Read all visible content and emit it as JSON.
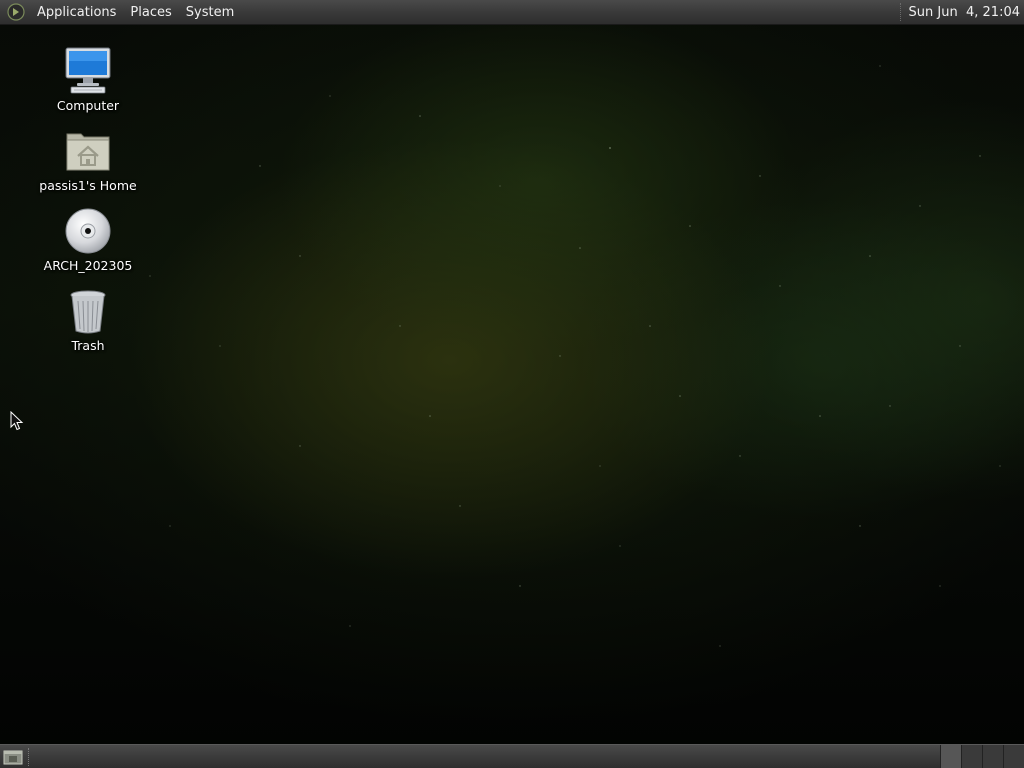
{
  "top_panel": {
    "menus": [
      "Applications",
      "Places",
      "System"
    ],
    "clock": "Sun Jun  4, 21:04"
  },
  "desktop": {
    "icons": [
      {
        "label": "Computer",
        "icon": "computer-icon"
      },
      {
        "label": "passis1's Home",
        "icon": "home-folder-icon"
      },
      {
        "label": "ARCH_202305",
        "icon": "optical-disc-icon"
      },
      {
        "label": "Trash",
        "icon": "trash-icon"
      }
    ]
  },
  "bottom_panel": {
    "show_desktop_icon": "show-desktop-icon",
    "workspaces": [
      {
        "active": true
      },
      {
        "active": false
      },
      {
        "active": false
      },
      {
        "active": false
      }
    ]
  },
  "colors": {
    "panel": "#3a3a3a",
    "panel_text": "#f0f0f0",
    "desktop_bg": "#0a0f08"
  }
}
